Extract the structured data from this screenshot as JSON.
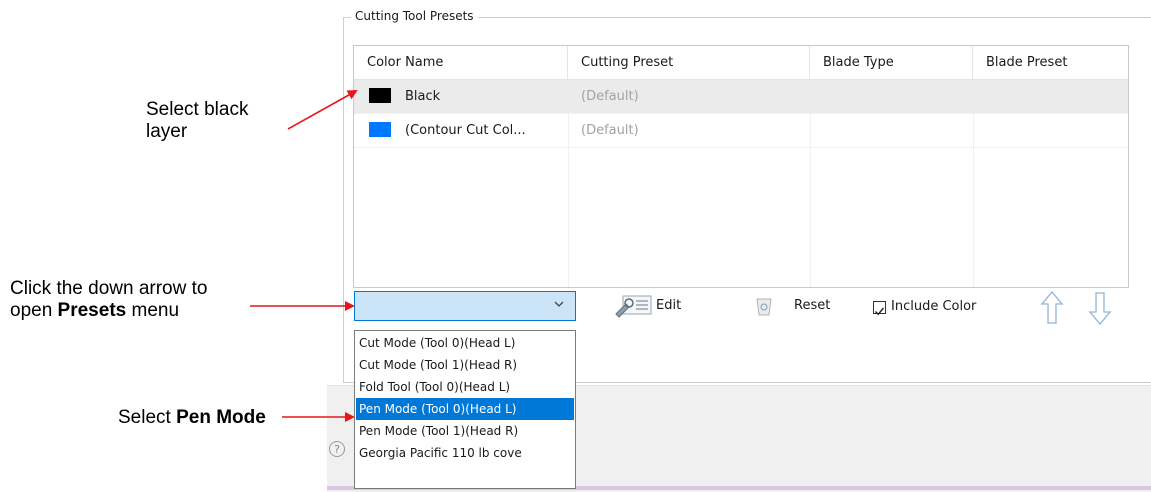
{
  "annotations": {
    "select_black_line1": "Select black",
    "select_black_line2": "layer",
    "click_arrow_line1": "Click the down arrow to",
    "click_arrow_line2_prefix": "open ",
    "click_arrow_line2_bold": "Presets",
    "click_arrow_line2_suffix": " menu",
    "select_pen_prefix": "Select ",
    "select_pen_bold": "Pen Mode",
    "arrow_color": "#e8151b"
  },
  "group": {
    "title": "Cutting Tool Presets"
  },
  "table": {
    "columns": [
      "Color Name",
      "Cutting Preset",
      "Blade Type",
      "Blade Preset"
    ],
    "rows": [
      {
        "swatch": "#000000",
        "color_name": "Black",
        "cutting_preset": "(Default)",
        "blade_type": "",
        "blade_preset": "",
        "selected": true
      },
      {
        "swatch": "#0078ff",
        "color_name": "(Contour Cut Col...",
        "cutting_preset": "(Default)",
        "blade_type": "",
        "blade_preset": "",
        "selected": false
      }
    ]
  },
  "combo": {
    "value": "",
    "arrow_icon": "chevron-down-icon"
  },
  "toolbar": {
    "edit_label": "Edit",
    "reset_label": "Reset",
    "include_color_label": "Include Color",
    "include_color_checked": true
  },
  "dropdown": {
    "items": [
      "Cut Mode (Tool 0)(Head L)",
      "Cut Mode (Tool 1)(Head R)",
      "Fold Tool (Tool 0)(Head L)",
      "Pen Mode (Tool 0)(Head L)",
      "Pen Mode (Tool 1)(Head R)",
      "Georgia Pacific 110 lb cove"
    ],
    "highlighted_index": 3
  },
  "help_glyph": "?"
}
